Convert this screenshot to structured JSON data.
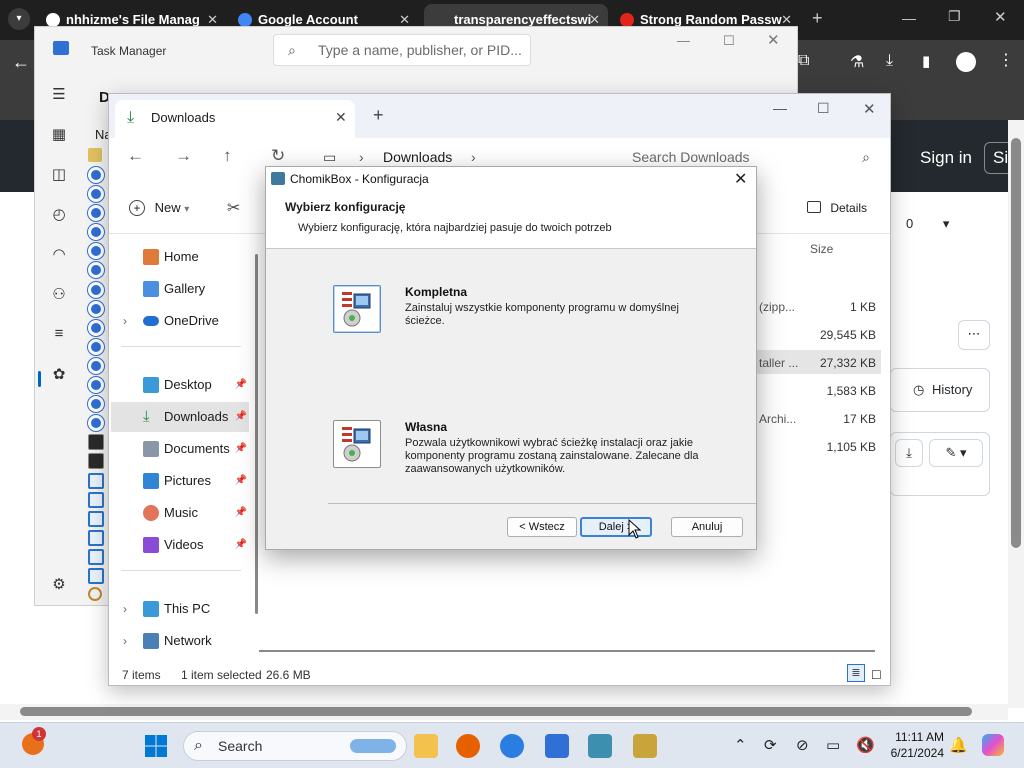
{
  "browser": {
    "tabs": [
      {
        "label": "nhhizme's File Manag",
        "favicon_color": "#ffffff"
      },
      {
        "label": "Google Account",
        "favicon_color": "#4285f4"
      },
      {
        "label": "transparencyeffectswi",
        "favicon_color": "#3c3c3c"
      },
      {
        "label": "Strong Random Passw",
        "favicon_color": "#e1251b"
      }
    ],
    "signin_label": "Sign in",
    "signin_partial": "Si",
    "star_count": "0",
    "history_label": "History"
  },
  "task_manager": {
    "title": "Task Manager",
    "search_placeholder": "Type a name, publisher, or PID...",
    "column_partial": "Na",
    "d_partial": "D"
  },
  "explorer": {
    "tab_label": "Downloads",
    "breadcrumb": "Downloads",
    "search_placeholder": "Search Downloads",
    "new_label": "New",
    "details_label": "Details",
    "size_header": "Size",
    "sidebar": [
      {
        "label": "Home",
        "icon": "home-icon",
        "group": 1
      },
      {
        "label": "Gallery",
        "icon": "gallery-icon",
        "group": 1
      },
      {
        "label": "OneDrive",
        "icon": "cloud-icon",
        "group": 1,
        "expandable": true
      },
      {
        "label": "Desktop",
        "icon": "desktop-icon",
        "group": 2,
        "pinned": true
      },
      {
        "label": "Downloads",
        "icon": "download-icon",
        "group": 2,
        "pinned": true,
        "selected": true
      },
      {
        "label": "Documents",
        "icon": "documents-icon",
        "group": 2,
        "pinned": true
      },
      {
        "label": "Pictures",
        "icon": "pictures-icon",
        "group": 2,
        "pinned": true
      },
      {
        "label": "Music",
        "icon": "music-icon",
        "group": 2,
        "pinned": true
      },
      {
        "label": "Videos",
        "icon": "videos-icon",
        "group": 2,
        "pinned": true
      },
      {
        "label": "This PC",
        "icon": "pc-icon",
        "group": 3,
        "expandable": true
      },
      {
        "label": "Network",
        "icon": "network-icon",
        "group": 3,
        "expandable": true
      }
    ],
    "files": [
      {
        "name_partial": "(zipp...",
        "size": "1 KB"
      },
      {
        "name_partial": "",
        "size": "29,545 KB"
      },
      {
        "name_partial": "taller ...",
        "size": "27,332 KB",
        "highlighted": true
      },
      {
        "name_partial": "",
        "size": "1,583 KB"
      },
      {
        "name_partial": "Archi...",
        "size": "17 KB"
      },
      {
        "name_partial": "",
        "size": "1,105 KB"
      }
    ],
    "status": {
      "items": "7 items",
      "selected": "1 item selected",
      "selected_size": "26.6 MB"
    }
  },
  "dialog": {
    "title": "ChomikBox - Konfiguracja",
    "heading": "Wybierz konfigurację",
    "subheading": "Wybierz konfigurację, która najbardziej pasuje do twoich potrzeb",
    "options": [
      {
        "title": "Kompletna",
        "description": "Zainstaluj wszystkie komponenty programu w domyślnej ścieżce."
      },
      {
        "title": "Własna",
        "description": "Pozwala użytkownikowi wybrać ścieżkę instalacji oraz jakie komponenty programu zostaną zainstalowane. Zalecane dla zaawansowanych użytkowników."
      }
    ],
    "buttons": {
      "back": "< Wstecz",
      "next": "Dalej >",
      "cancel": "Anuluj"
    }
  },
  "taskbar": {
    "search_label": "Search",
    "time": "11:11 AM",
    "date": "6/21/2024",
    "notification_badge": "1"
  }
}
